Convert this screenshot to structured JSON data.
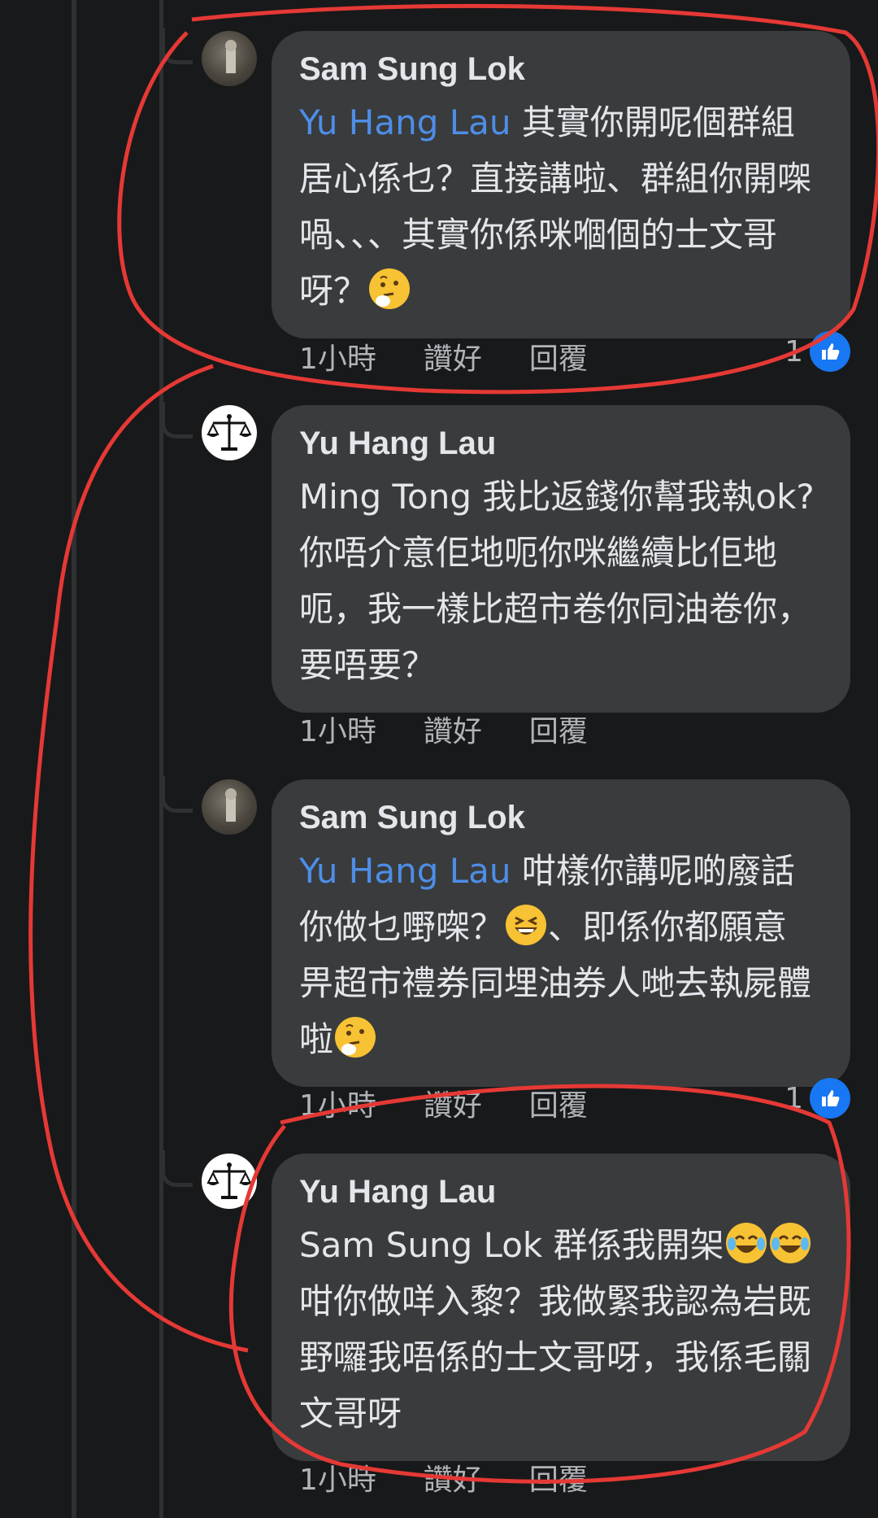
{
  "comments": [
    {
      "author": "Sam Sung Lok",
      "mention": "Yu Hang Lau",
      "line1": " 其實你開呢個群組",
      "line2": "居心係乜？直接講啦、群組你開㗎",
      "line3": "喎、、、其實你係咪嗰個的士文哥",
      "line4": "呀？",
      "time": "1小時",
      "like": "讚好",
      "reply": "回覆",
      "reactions": "1"
    },
    {
      "author": "Yu Hang Lau",
      "line1": "Ming Tong 我比返錢你幫我執ok?",
      "line2": "你唔介意佢地呃你咪繼續比佢地",
      "line3": "呃，我一樣比超市卷你同油卷你，",
      "line4": "要唔要？",
      "time": "1小時",
      "like": "讚好",
      "reply": "回覆"
    },
    {
      "author": "Sam Sung Lok",
      "mention": "Yu Hang Lau",
      "line1": " 咁樣你講呢啲廢話",
      "line2a": "你做乜嘢㗎？",
      "line2b": "、即係你都願意",
      "line3": "畀超市禮券同埋油券人哋去執屍體",
      "line4": "啦",
      "time": "1小時",
      "like": "讚好",
      "reply": "回覆",
      "reactions": "1"
    },
    {
      "author": "Yu Hang Lau",
      "line1": "Sam Sung Lok 群係我開架",
      "line2": "咁你做咩入黎？我做緊我認為岩既",
      "line3": "野囉我唔係的士文哥呀，我係毛關",
      "line4": "文哥呀",
      "time": "1小時",
      "like": "讚好",
      "reply": "回覆"
    }
  ],
  "icons": {
    "thinking": "thinking-face-emoji",
    "laughing": "grinning-squinting-face-emoji",
    "tears": "face-with-tears-of-joy-emoji",
    "like": "thumbs-up-icon"
  },
  "colors": {
    "background": "#18191a",
    "bubble": "#3a3b3c",
    "text": "#e4e6eb",
    "mention": "#4d8ee8",
    "meta": "#b0b3b8",
    "like_badge": "#1877f2",
    "annotation": "#e53935"
  }
}
